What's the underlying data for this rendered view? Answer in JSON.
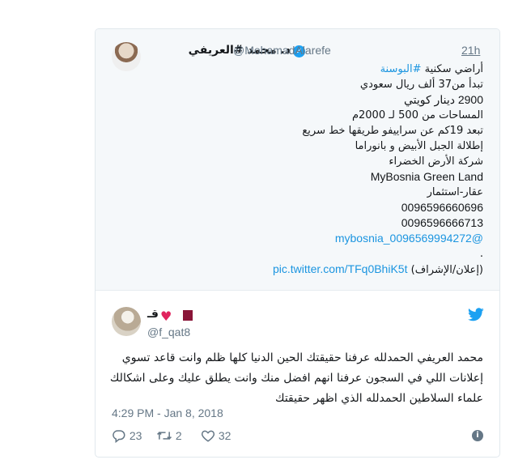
{
  "quoted_tweet": {
    "display_name": "د. محمد #العريفي",
    "handle": "@MohamadAlarefe",
    "time": "21h",
    "lines": [
      {
        "text": "أراضي سكنية ",
        "tag": "#البوسنة"
      },
      {
        "text": "تبدأ من37 ألف ريال سعودي"
      },
      {
        "text": "2900 دينار كويتي"
      },
      {
        "text": "المساحات من 500 لـ 2000م"
      },
      {
        "text": "تبعد 19كم عن سراييفو طريقها خط سريع"
      },
      {
        "text": "إطلالة الجبل الأبيض و بانوراما"
      },
      {
        "text": "شركة الأرض الخضراء"
      },
      {
        "text": "MyBosnia Green Land"
      },
      {
        "text": "عقار-استثمار"
      },
      {
        "text": "0096596660696"
      },
      {
        "text": "0096596666713"
      },
      {
        "text": "@mybosnia_0096569994272"
      },
      {
        "text": "."
      }
    ],
    "footer_text": "(إعلان/الإشراف)",
    "footer_link": "pic.twitter.com/TFq0BhiK5t"
  },
  "main_tweet": {
    "display_name": "قـ",
    "handle": "@f_qat8",
    "body": "محمد العريفي الحمدلله عرفنا حقيقتك الحين الدنيا كلها ظلم وانت قاعد تسوي إعلانات اللي في السجون عرفنا انهم افضل منك وانت يطلق عليك وعلى اشكالك علماء السلاطين الحمدلله الذي اظهر حقيقتك",
    "timestamp": "4:29 PM - Jan 8, 2018",
    "replies": "23",
    "retweets": "2",
    "likes": "32"
  },
  "icons": {
    "verified": "verified-badge-icon",
    "heart": "heart-emoji-icon",
    "flag": "qatar-flag-icon",
    "bird": "twitter-bird-icon",
    "reply": "reply-icon",
    "retweet": "retweet-icon",
    "like": "like-icon",
    "info": "info-icon"
  },
  "colors": {
    "accent": "#1da1f2",
    "link": "#1b95e0",
    "muted": "#657786",
    "heart": "#e0245e"
  }
}
